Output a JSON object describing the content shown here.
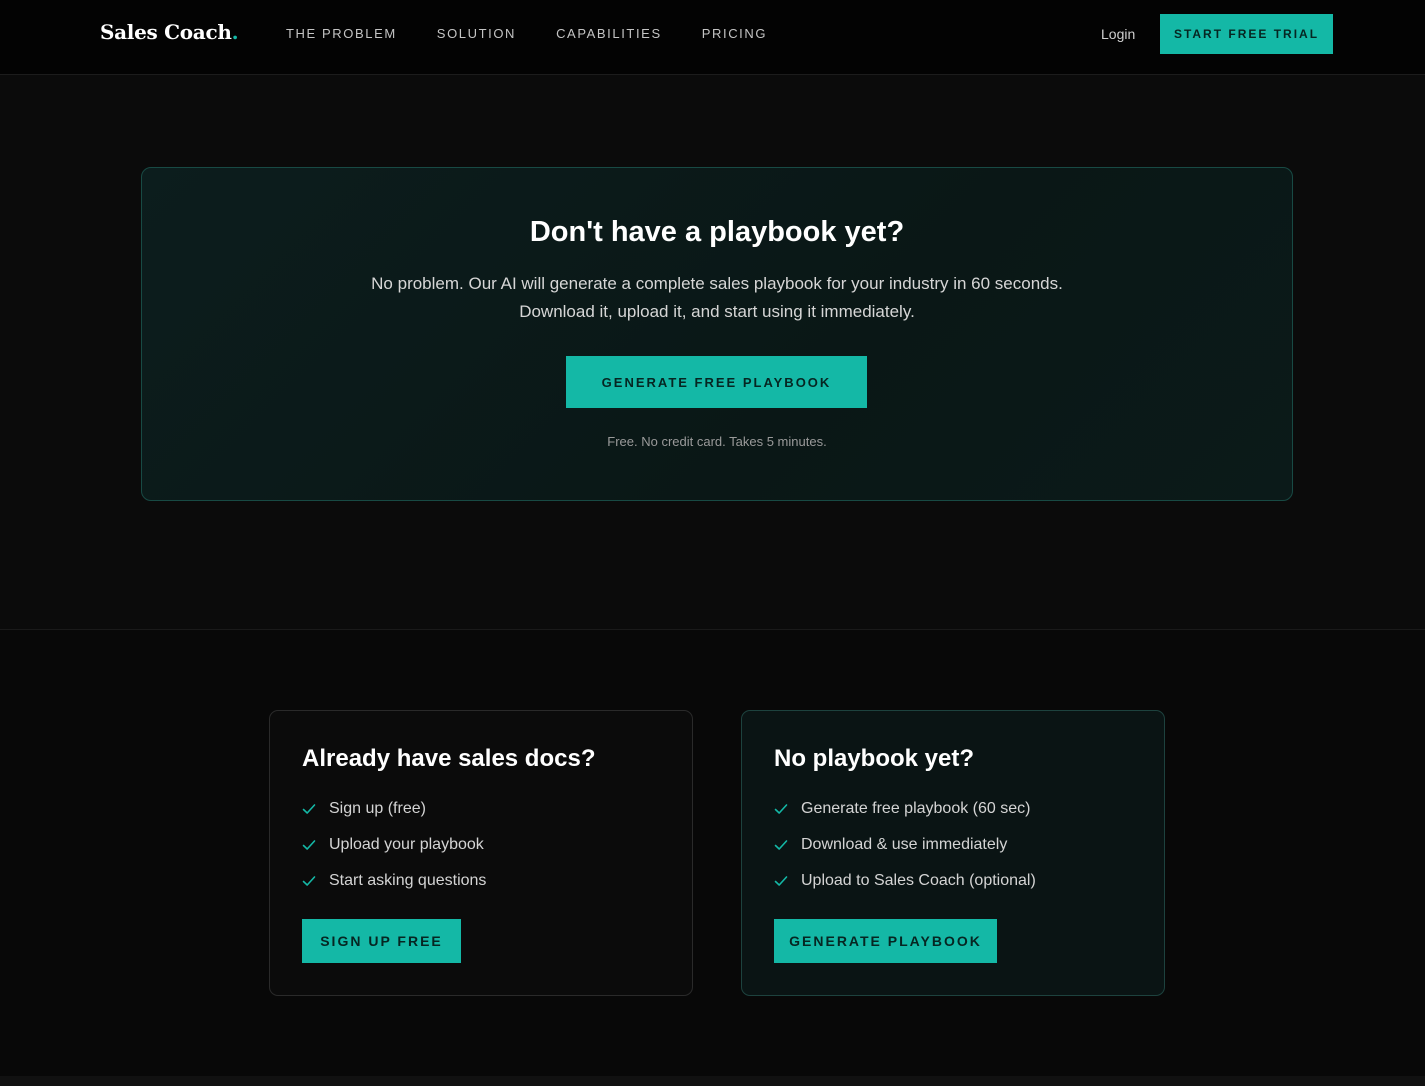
{
  "header": {
    "logo_text": "Sales Coach",
    "logo_dot": ".",
    "nav": [
      "THE PROBLEM",
      "SOLUTION",
      "CAPABILITIES",
      "PRICING"
    ],
    "login_label": "Login",
    "trial_label": "START FREE TRIAL"
  },
  "hero": {
    "title": "Don't have a playbook yet?",
    "subtitle_line1": "No problem. Our AI will generate a complete sales playbook for your industry in 60 seconds.",
    "subtitle_line2": "Download it, upload it, and start using it immediately.",
    "button_label": "GENERATE FREE PLAYBOOK",
    "note": "Free. No credit card. Takes 5 minutes."
  },
  "options": {
    "left": {
      "title": "Already have sales docs?",
      "items": [
        "Sign up (free)",
        "Upload your playbook",
        "Start asking questions"
      ],
      "button_label": "SIGN UP FREE"
    },
    "right": {
      "title": "No playbook yet?",
      "items": [
        "Generate free playbook (60 sec)",
        "Download & use immediately",
        "Upload to Sales Coach (optional)"
      ],
      "button_label": "GENERATE PLAYBOOK"
    }
  },
  "colors": {
    "accent": "#14b8a6",
    "background": "#0a0a0a",
    "card_border_teal": "#184a44"
  },
  "icons": {
    "checklist": "check-icon"
  }
}
